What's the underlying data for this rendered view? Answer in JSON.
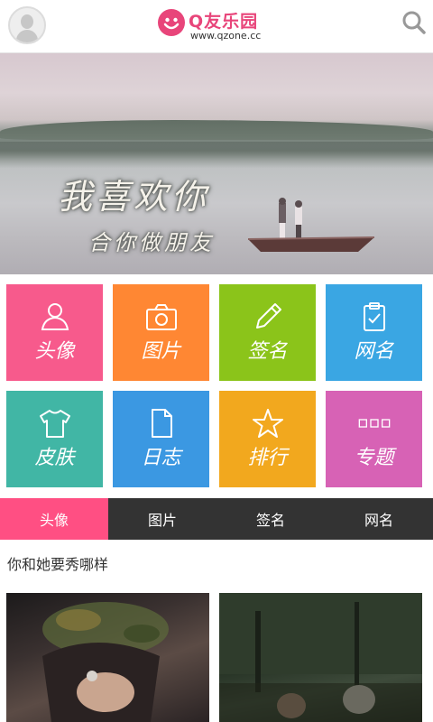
{
  "header": {
    "avatar_icon": "user-avatar-icon",
    "logo_title": "Q友乐园",
    "logo_url": "www.qzone.cc",
    "search_icon": "search-icon",
    "brand_color": "#e8457a"
  },
  "banner": {
    "line1": "我喜欢你",
    "line2": "合你做朋友",
    "slides": 6,
    "active_slide": 1
  },
  "tiles": [
    {
      "label": "头像",
      "icon": "user-outline-icon",
      "color": "#f75a8c"
    },
    {
      "label": "图片",
      "icon": "camera-icon",
      "color": "#ff8733"
    },
    {
      "label": "签名",
      "icon": "pencil-icon",
      "color": "#8bc41a"
    },
    {
      "label": "网名",
      "icon": "clipboard-check-icon",
      "color": "#3aa6e3"
    },
    {
      "label": "皮肤",
      "icon": "tshirt-icon",
      "color": "#41b6a5"
    },
    {
      "label": "日志",
      "icon": "document-icon",
      "color": "#3b98e2"
    },
    {
      "label": "排行",
      "icon": "star-icon",
      "color": "#f2a81e"
    },
    {
      "label": "专题",
      "icon": "three-squares-icon",
      "color": "#d762b5"
    }
  ],
  "tabs": [
    {
      "label": "头像",
      "active": true
    },
    {
      "label": "图片",
      "active": false
    },
    {
      "label": "签名",
      "active": false
    },
    {
      "label": "网名",
      "active": false
    }
  ],
  "section": {
    "title": "你和她要秀哪样"
  }
}
